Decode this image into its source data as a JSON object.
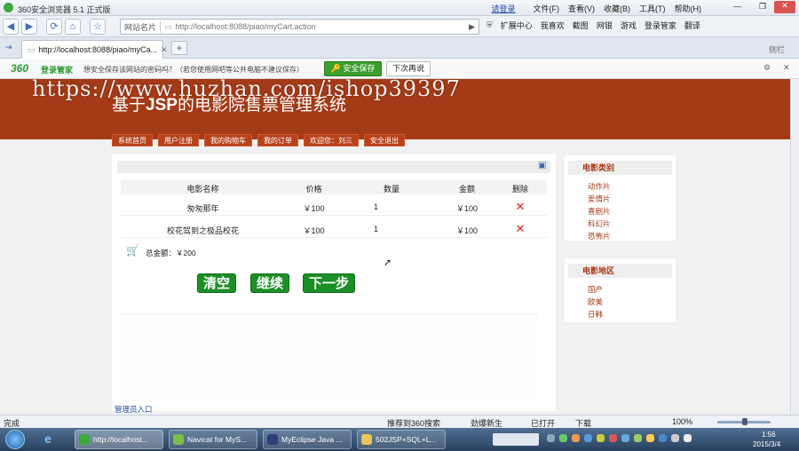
{
  "browser": {
    "title": "360安全浏览器 5.1 正式版",
    "login_link": "请登录",
    "menus": [
      "文件(F)",
      "查看(V)",
      "收藏(B)",
      "工具(T)",
      "帮助(H)"
    ],
    "site_name_btn": "网站名片",
    "address": "http://localhost:8088/piao/myCart.action",
    "toolbar": [
      "扩展中心",
      "我喜欢",
      "截图",
      "网银",
      "游戏",
      "登录管家",
      "翻译"
    ],
    "tab_title": "http://localhost:8088/piao/myCa...",
    "sidebar_label": "侧栏"
  },
  "pwdbar": {
    "brand": "360",
    "brand_label": "登录管家",
    "question": "想安全保存该网站的密码吗？（若您使用网吧等公共电脑不建议保存）",
    "save_label": "安全保存",
    "later_label": "下次再说"
  },
  "watermark": "https://www.huzhan.com/ishop39397",
  "site": {
    "title_prefix": "基于",
    "title_bold": "JSP",
    "title_suffix": "的电影院售票管理系统",
    "nav": [
      "系统首页",
      "用户注册",
      "我的购物车",
      "我的订单",
      "欢迎您：刘三",
      "安全退出"
    ],
    "admin_link": "管理员入口"
  },
  "cart": {
    "headers": [
      "电影名称",
      "价格",
      "数量",
      "金额",
      "删除"
    ],
    "rows": [
      {
        "name": "匆匆那年",
        "price": "￥100",
        "qty": "1",
        "amount": "￥100"
      },
      {
        "name": "校花驾到之极品校花",
        "price": "￥100",
        "qty": "1",
        "amount": "￥100"
      }
    ],
    "total": "总金额：￥200",
    "buttons": [
      "清空",
      "继续",
      "下一步"
    ]
  },
  "sidebar": {
    "category_title": "电影类别",
    "categories": [
      "动作片",
      "爱情片",
      "喜剧片",
      "科幻片",
      "恐怖片"
    ],
    "region_title": "电影地区",
    "regions": [
      "国产",
      "欧美",
      "日韩"
    ]
  },
  "status": {
    "left": "完成",
    "search": "推荐到360搜索",
    "news": "劲爆新生",
    "reload": "已打开",
    "download": "下载",
    "zoom": "100%"
  },
  "taskbar": {
    "items": [
      "http://localhost...",
      "Navicat for MyS...",
      "MyEclipse Java ...",
      "502JSP+SQL+L..."
    ],
    "time": "1:56",
    "date": "2015/3/4"
  }
}
